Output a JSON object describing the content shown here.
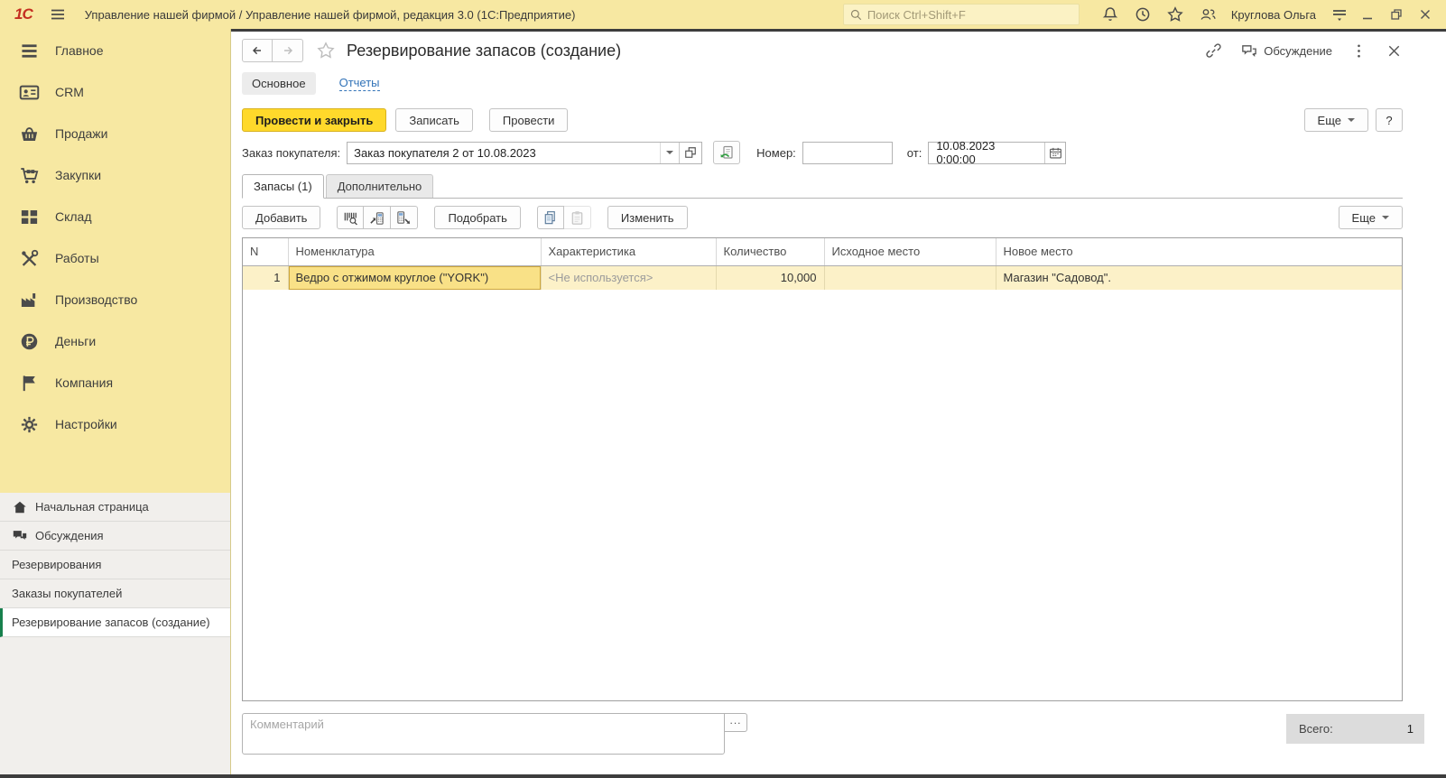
{
  "titlebar": {
    "app_title": "Управление нашей фирмой / Управление нашей фирмой, редакция 3.0  (1С:Предприятие)",
    "logo_text": "1С",
    "search_placeholder": "Поиск Ctrl+Shift+F",
    "user_name": "Круглова Ольга"
  },
  "sidebar": {
    "items": [
      {
        "label": "Главное"
      },
      {
        "label": "CRM"
      },
      {
        "label": "Продажи"
      },
      {
        "label": "Закупки"
      },
      {
        "label": "Склад"
      },
      {
        "label": "Работы"
      },
      {
        "label": "Производство"
      },
      {
        "label": "Деньги"
      },
      {
        "label": "Компания"
      },
      {
        "label": "Настройки"
      }
    ],
    "panel": [
      {
        "label": "Начальная страница"
      },
      {
        "label": "Обсуждения"
      },
      {
        "label": "Резервирования"
      },
      {
        "label": "Заказы покупателей"
      },
      {
        "label": "Резервирование запасов (создание)"
      }
    ]
  },
  "form": {
    "title": "Резервирование запасов (создание)",
    "discussion_label": "Обсуждение",
    "nav_tabs": {
      "main": "Основное",
      "reports": "Отчеты"
    },
    "commands": {
      "post_and_close": "Провести и закрыть",
      "write": "Записать",
      "post": "Провести",
      "more": "Еще",
      "help": "?"
    },
    "header_fields": {
      "order_label": "Заказ покупателя:",
      "order_value": "Заказ покупателя 2 от 10.08.2023",
      "number_label": "Номер:",
      "number_value": "",
      "date_label": "от:",
      "date_value": "10.08.2023  0:00:00"
    },
    "tabs": {
      "stock": "Запасы (1)",
      "additional": "Дополнительно"
    },
    "toolbar": {
      "add": "Добавить",
      "pick": "Подобрать",
      "edit": "Изменить",
      "more": "Еще"
    },
    "table": {
      "columns": [
        "N",
        "Номенклатура",
        "Характеристика",
        "Количество",
        "Исходное место",
        "Новое место"
      ],
      "row": {
        "n": "1",
        "nomenclature": "Ведро с отжимом  круглое (\"YORK\")",
        "characteristic": "<Не используется>",
        "quantity": "10,000",
        "source_place": "",
        "new_place": "Магазин \"Садовод\"."
      }
    },
    "comment_placeholder": "Комментарий",
    "footer": {
      "total_label": "Всего:",
      "total_value": "1"
    }
  },
  "colors": {
    "panel_yellow": "#f7e8a2",
    "primary_button_yellow": "#ffd92b",
    "selected_row_yellow": "#fcf1c8",
    "active_cell_yellow": "#f9e187",
    "link_blue": "#3273b8",
    "logo_red": "#c42e21",
    "active_item_green": "#17804d"
  }
}
